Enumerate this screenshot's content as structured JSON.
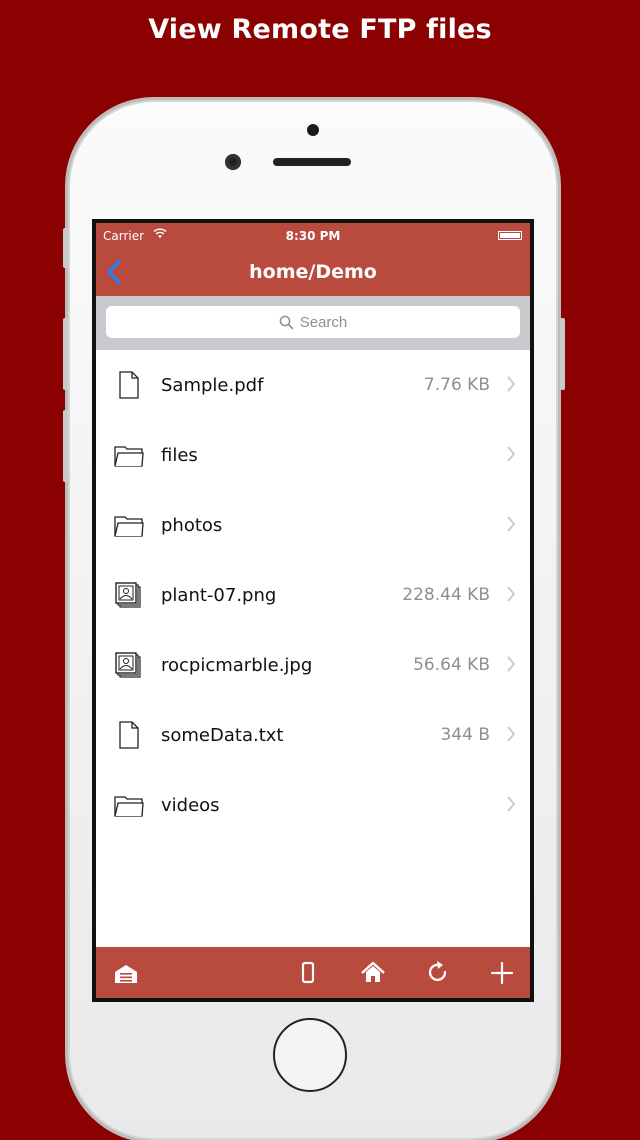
{
  "headline": "View Remote FTP files",
  "status": {
    "carrier": "Carrier",
    "time": "8:30 PM"
  },
  "nav": {
    "title": "home/Demo",
    "back_icon": "chevron-left-icon"
  },
  "search": {
    "placeholder": "Search"
  },
  "files": [
    {
      "name": "Sample.pdf",
      "size": "7.76 KB",
      "icon": "file-icon"
    },
    {
      "name": "files",
      "size": "",
      "icon": "folder-icon"
    },
    {
      "name": "photos",
      "size": "",
      "icon": "folder-icon"
    },
    {
      "name": "plant-07.png",
      "size": "228.44 KB",
      "icon": "image-icon"
    },
    {
      "name": "rocpicmarble.jpg",
      "size": "56.64 KB",
      "icon": "image-icon"
    },
    {
      "name": "someData.txt",
      "size": "344 B",
      "icon": "file-icon"
    },
    {
      "name": "videos",
      "size": "",
      "icon": "folder-icon"
    }
  ],
  "toolbar": {
    "icons": [
      "server-icon",
      "phone-device-icon",
      "home-icon",
      "refresh-icon",
      "add-icon"
    ]
  },
  "colors": {
    "background": "#8b0000",
    "bar": "#b84a3e",
    "back_chevron": "#2a7df0"
  }
}
